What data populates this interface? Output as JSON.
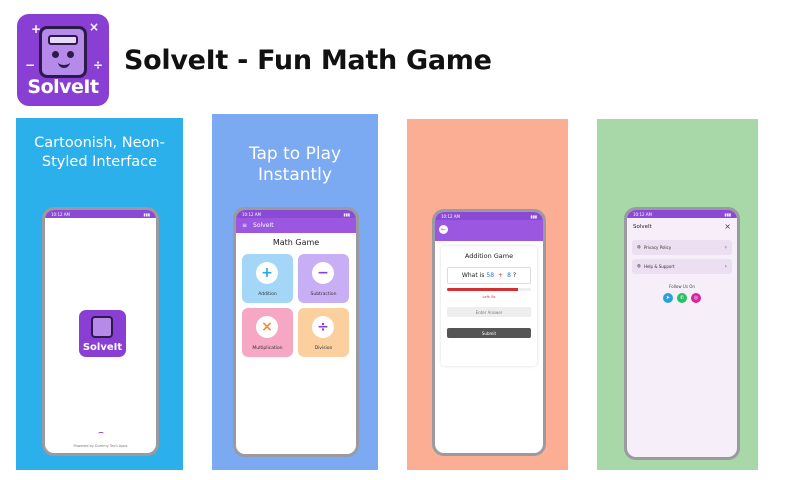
{
  "header": {
    "logo_wordmark": "SolveIt",
    "title": "SolveIt - Fun Math Game"
  },
  "colors": {
    "brand_purple": "#8a3fd4",
    "panel_1_bg": "#2cb0ec",
    "panel_2_bg": "#7baaf3",
    "panel_3_bg": "#fcae94",
    "panel_4_bg": "#a8d8a8"
  },
  "panels": [
    {
      "caption_lines": [
        "Cartoonish, Neon-",
        "Styled Interface"
      ],
      "phone": {
        "status_time": "10:12 AM",
        "logo_wordmark": "SolveIt",
        "footer": "Powered by Dummy Tech Apps"
      }
    },
    {
      "caption_lines": [
        "Tap to Play",
        "Instantly"
      ],
      "phone": {
        "status_time": "10:12 AM",
        "appbar_title": "SolveIt",
        "screen_title": "Math Game",
        "tiles": [
          {
            "label": "Addition",
            "symbol": "+"
          },
          {
            "label": "Subtraction",
            "symbol": "−"
          },
          {
            "label": "Multiplication",
            "symbol": "×"
          },
          {
            "label": "Division",
            "symbol": "÷"
          }
        ]
      }
    },
    {
      "phone": {
        "status_time": "10:12 AM",
        "screen_title": "Addition Game",
        "question_prefix": "What is",
        "operand_a": "58",
        "operator": "+",
        "operand_b": "8",
        "question_suffix": "?",
        "timer_fraction": 0.85,
        "time_left": "Left: 8s",
        "answer_placeholder": "Enter Answer",
        "submit_label": "Submit"
      }
    },
    {
      "phone": {
        "status_time": "10:12 AM",
        "drawer_title": "SolveIt",
        "menu": [
          {
            "label": "Privacy Policy",
            "icon": "shield-icon"
          },
          {
            "label": "Help & Support",
            "icon": "help-icon"
          }
        ],
        "follow_label": "Follow Us On",
        "socials": [
          "telegram-icon",
          "whatsapp-icon",
          "instagram-icon"
        ]
      }
    }
  ]
}
